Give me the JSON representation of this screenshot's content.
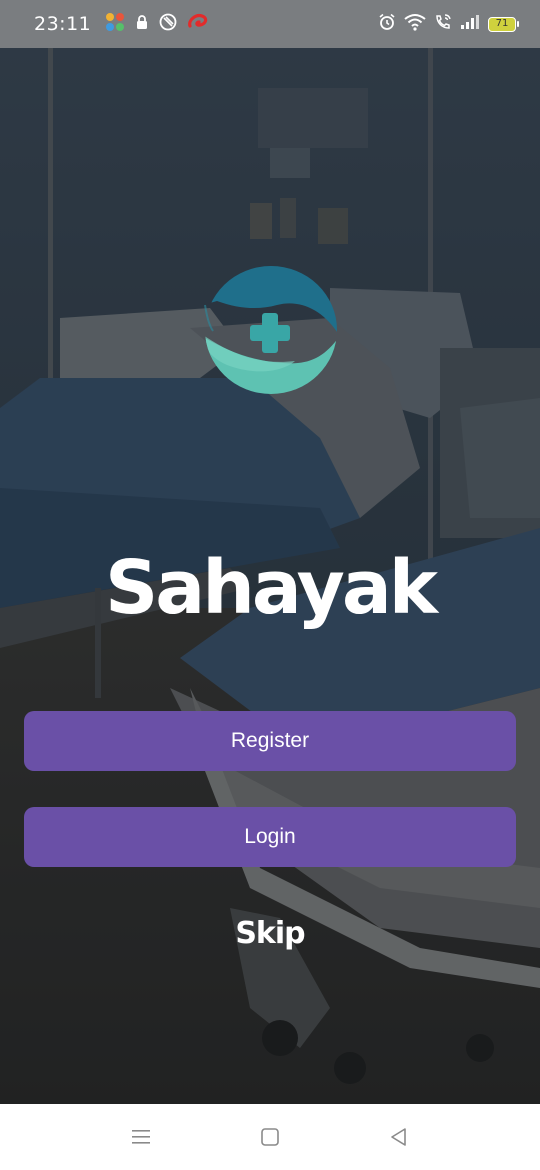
{
  "status_bar": {
    "time": "23:11",
    "battery_level": "71",
    "left_icons": [
      "app-grid-icon",
      "lock-icon",
      "shield-icon",
      "airtel-icon"
    ],
    "right_icons": [
      "alarm-icon",
      "wifi-icon",
      "wifi-call-icon",
      "signal-icon",
      "battery-icon"
    ]
  },
  "app": {
    "title": "Sahayak",
    "logo_icon": "medical-cross-wave-logo"
  },
  "actions": {
    "register_label": "Register",
    "login_label": "Login",
    "skip_label": "Skip"
  },
  "nav_bar": {
    "items": [
      "menu-icon",
      "home-icon",
      "back-icon"
    ]
  },
  "colors": {
    "button": "#6a50a7",
    "logo_dark": "#1f6f8b",
    "logo_light": "#5fc3b3",
    "cross": "#3aa7a5"
  }
}
